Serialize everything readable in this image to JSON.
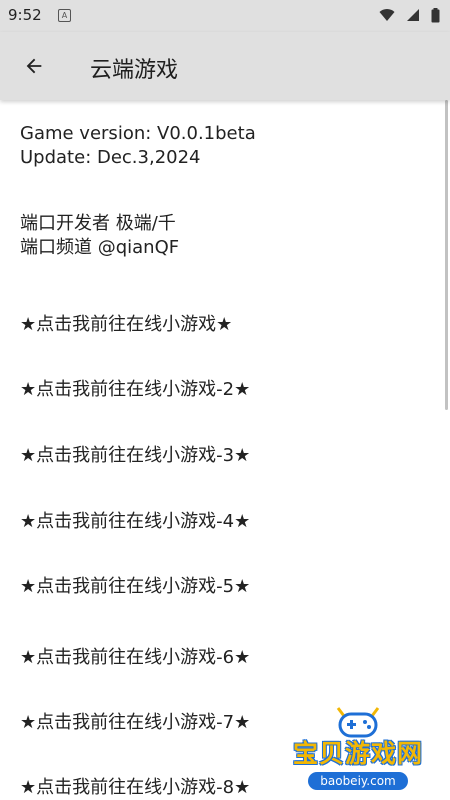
{
  "status_bar": {
    "time": "9:52",
    "notification_icon": "A"
  },
  "app_bar": {
    "title": "云端游戏",
    "back_icon": "arrow-left-icon"
  },
  "info": {
    "version_line": "Game version: V0.0.1beta",
    "update_line": "Update: Dec.3,2024",
    "developer_line": "端口开发者 极端/千",
    "channel_line": "端口频道 @qianQF"
  },
  "links": [
    "★点击我前往在线小游戏★",
    "★点击我前往在线小游戏-2★",
    "★点击我前往在线小游戏-3★",
    "★点击我前往在线小游戏-4★",
    "★点击我前往在线小游戏-5★",
    "★点击我前往在线小游戏-6★",
    "★点击我前往在线小游戏-7★",
    "★点击我前往在线小游戏-8★"
  ],
  "watermark": {
    "title": "宝贝游戏网",
    "url": "baobeiy.com"
  },
  "colors": {
    "app_bar_bg": "#e0e0e0",
    "watermark_yellow": "#f2b705",
    "watermark_blue": "#1e6fd6"
  }
}
